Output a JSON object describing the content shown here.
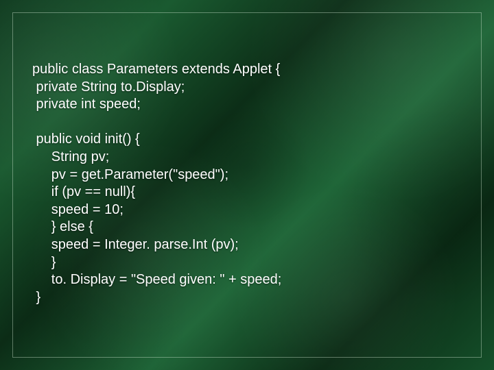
{
  "code": {
    "lines": [
      "public class Parameters extends Applet {",
      " private String to.Display;",
      " private int speed;",
      "",
      " public void init() {",
      "     String pv;",
      "     pv = get.Parameter(\"speed\");",
      "     if (pv == null){",
      "     speed = 10;",
      "     } else {",
      "     speed = Integer. parse.Int (pv);",
      "     }",
      "     to. Display = \"Speed given: \" + speed;",
      " }"
    ]
  }
}
